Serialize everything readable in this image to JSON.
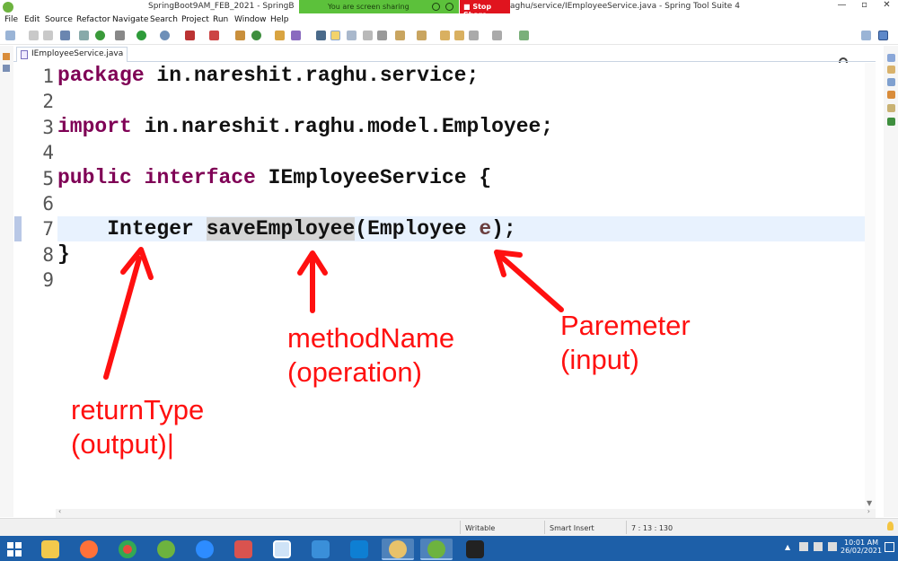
{
  "window": {
    "title_left": "SpringBoot9AM_FEB_2021 - SpringB",
    "title_right": "aghu/service/IEmployeeService.java - Spring Tool Suite 4",
    "controls": [
      "—",
      "▫",
      "✕"
    ]
  },
  "screen_share": {
    "message": "You are screen sharing",
    "stop_label": "Stop Share"
  },
  "menu": [
    "File",
    "Edit",
    "Source",
    "Refactor",
    "Navigate",
    "Search",
    "Project",
    "Run",
    "Window",
    "Help"
  ],
  "editor": {
    "tab_label": "IEmployeeService.java",
    "line_numbers": [
      "1",
      "2",
      "3",
      "4",
      "5",
      "6",
      "7",
      "8",
      "9"
    ],
    "code": {
      "l1_kw": "package",
      "l1_rest": " in.nareshit.raghu.service;",
      "l3_kw": "import",
      "l3_rest": " in.nareshit.raghu.model.Employee;",
      "l5_kw1": "public",
      "l5_kw2": "interface",
      "l5_rest": " IEmployeeService {",
      "l7_indent_type": "    Integer ",
      "l7_method": "saveEmployee",
      "l7_paren": "(Employee ",
      "l7_param": "e",
      "l7_end": ");",
      "l8": "}"
    }
  },
  "annotations": {
    "return_type": "returnType\n(output)|",
    "method_name": "methodName\n(operation)",
    "parameter": "Paremeter\n(input)"
  },
  "status": {
    "writable": "Writable",
    "insert_mode": "Smart Insert",
    "position": "7 : 13 : 130"
  },
  "taskbar": {
    "time": "10:01 AM",
    "date": "26/02/2021",
    "apps": [
      "file-explorer",
      "firefox",
      "chrome",
      "spring-tool-suite",
      "zoom",
      "paint",
      "search-app",
      "arrow-app",
      "vscode",
      "paint-palette",
      "spring-tool-suite-active",
      "mypaint"
    ],
    "annotation_color": "#ff1010"
  }
}
